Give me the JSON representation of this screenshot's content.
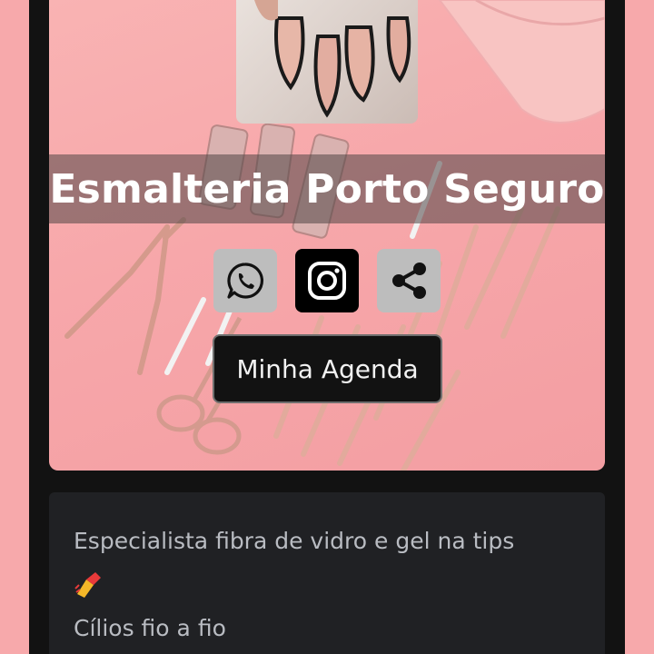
{
  "profile": {
    "name": "Esmalteria Porto Seguro"
  },
  "social": [
    {
      "name": "WhatsApp",
      "icon": "whatsapp-icon"
    },
    {
      "name": "Instagram",
      "icon": "instagram-icon"
    },
    {
      "name": "Share",
      "icon": "share-icon"
    }
  ],
  "actions": {
    "agenda_label": "Minha Agenda"
  },
  "bio": {
    "line1": "Especialista fibra de vidro e gel na tips",
    "emoji": "💅",
    "line2": "Cílios fio a fio"
  },
  "colors": {
    "page_background": "#f7a9ab",
    "column_background": "#121212",
    "card_background": "#202124",
    "bio_text": "#b9bcc2"
  }
}
